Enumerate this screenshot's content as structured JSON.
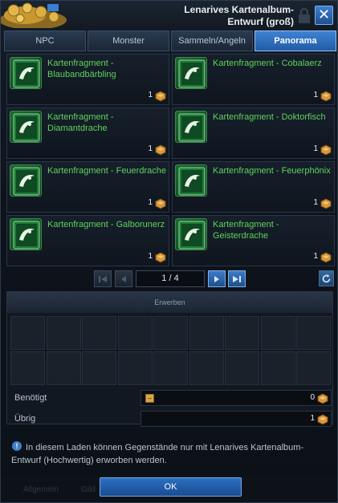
{
  "window": {
    "title_line1": "Lenarives Kartenalbum-",
    "title_line2": "Entwurf (groß)",
    "close_label": "✕"
  },
  "tabs": [
    {
      "label": "NPC",
      "active": false
    },
    {
      "label": "Monster",
      "active": false
    },
    {
      "label": "Sammeln/Angeln",
      "active": false
    },
    {
      "label": "Panorama",
      "active": true
    }
  ],
  "items": [
    {
      "name": "Kartenfragment - Blaubandbärbling",
      "count": "1"
    },
    {
      "name": "Kartenfragment - Cobalaerz",
      "count": "1"
    },
    {
      "name": "Kartenfragment - Diamantdrache",
      "count": "1"
    },
    {
      "name": "Kartenfragment - Doktorfisch",
      "count": "1"
    },
    {
      "name": "Kartenfragment - Feuerdrache",
      "count": "1"
    },
    {
      "name": "Kartenfragment - Feuerphönix",
      "count": "1"
    },
    {
      "name": "Kartenfragment - Galborunerz",
      "count": "1"
    },
    {
      "name": "Kartenfragment - Geisterdrache",
      "count": "1"
    }
  ],
  "pager": {
    "page": "1 / 4"
  },
  "purchase": {
    "header": "Erwerben",
    "needed_label": "Benötigt",
    "needed_value": "0",
    "remaining_label": "Übrig",
    "remaining_value": "1",
    "minus_label": "–"
  },
  "info": {
    "icon": "!",
    "text": "In diesem Laden können Gegenstände nur mit Lenarives Kartenalbum-Entwurf (Hochwertig) erworben werden."
  },
  "footer": {
    "ok_label": "OK",
    "ghost_left": "Allgemein",
    "ghost_mid": "Gild"
  },
  "colors": {
    "accent": "#2f74c8",
    "item_name": "#5fd35b",
    "currency": "#d8973a"
  }
}
